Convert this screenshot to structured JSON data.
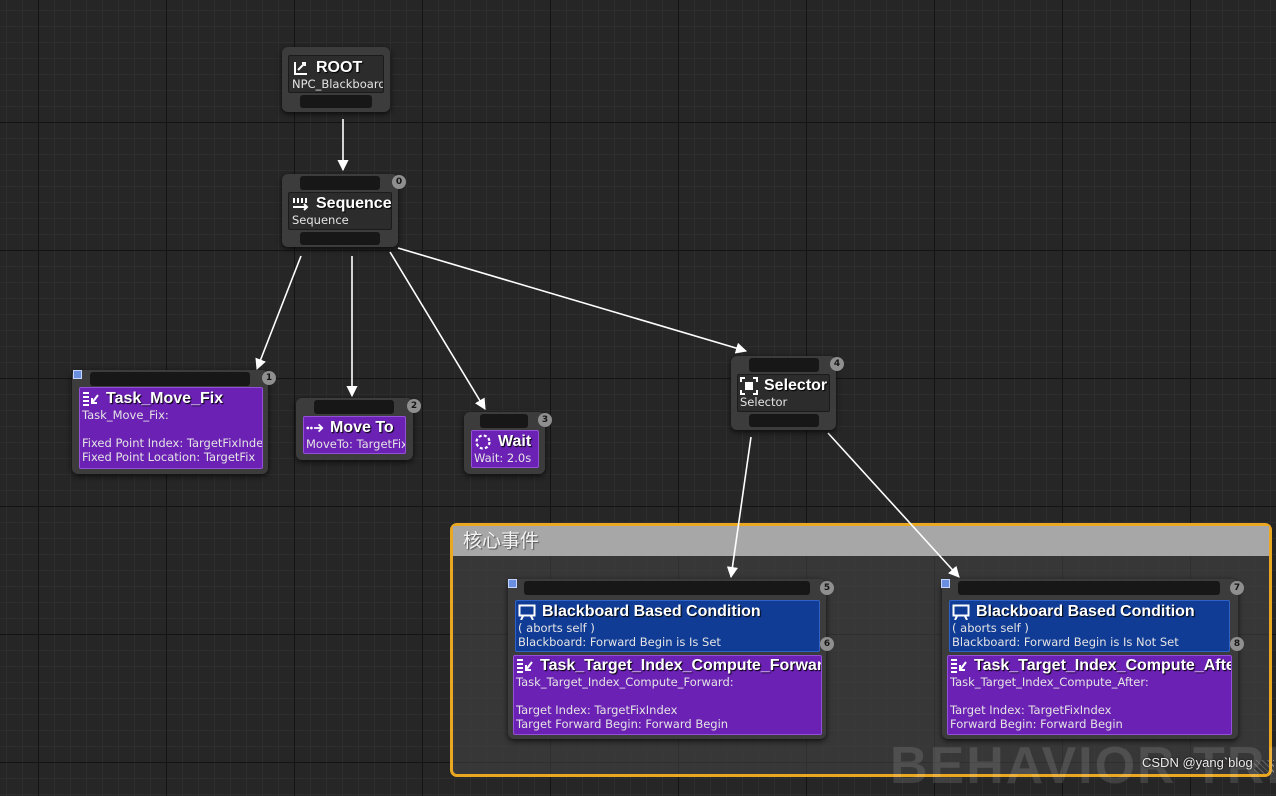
{
  "colors": {
    "comment_border": "#e9a722",
    "task": "#6b21b4",
    "decorator": "#103c95",
    "edge": "#ffffff"
  },
  "comment": {
    "title": "核心事件"
  },
  "watermark": "BEHAVIOR TREE",
  "credit": "CSDN @yang`blog",
  "nodes": {
    "root": {
      "icon": "root-icon",
      "title": "ROOT",
      "subtitle": "NPC_Blackboard"
    },
    "sequence": {
      "icon": "sequence-icon",
      "title": "Sequence",
      "subtitle": "Sequence",
      "index": "0"
    },
    "task_move_fix": {
      "icon": "task-icon",
      "title": "Task_Move_Fix",
      "lines": [
        "Task_Move_Fix:",
        "",
        "Fixed Point Index: TargetFixIndex",
        "Fixed Point Location: TargetFix"
      ],
      "index": "1"
    },
    "move_to": {
      "icon": "move-to-icon",
      "title": "Move To",
      "subtitle": "MoveTo: TargetFix",
      "index": "2"
    },
    "wait": {
      "icon": "wait-icon",
      "title": "Wait",
      "subtitle": "Wait: 2.0s",
      "index": "3"
    },
    "selector": {
      "icon": "selector-icon",
      "title": "Selector",
      "subtitle": "Selector",
      "index": "4"
    },
    "left_group": {
      "index": "5",
      "decorator": {
        "icon": "blackboard-icon",
        "title": "Blackboard Based Condition",
        "lines": [
          "( aborts self )",
          "Blackboard: Forward Begin is Is Set"
        ],
        "index": "6"
      },
      "task": {
        "icon": "task-icon",
        "title": "Task_Target_Index_Compute_Forward",
        "lines": [
          "Task_Target_Index_Compute_Forward:",
          "",
          "Target Index: TargetFixIndex",
          "Target Forward Begin: Forward Begin"
        ]
      }
    },
    "right_group": {
      "index": "7",
      "decorator": {
        "icon": "blackboard-icon",
        "title": "Blackboard Based Condition",
        "lines": [
          "( aborts self )",
          "Blackboard: Forward Begin is Is Not Set"
        ],
        "index": "8"
      },
      "task": {
        "icon": "task-icon",
        "title": "Task_Target_Index_Compute_After",
        "lines": [
          "Task_Target_Index_Compute_After:",
          "",
          "Target Index: TargetFixIndex",
          "Forward Begin: Forward Begin"
        ]
      }
    }
  }
}
